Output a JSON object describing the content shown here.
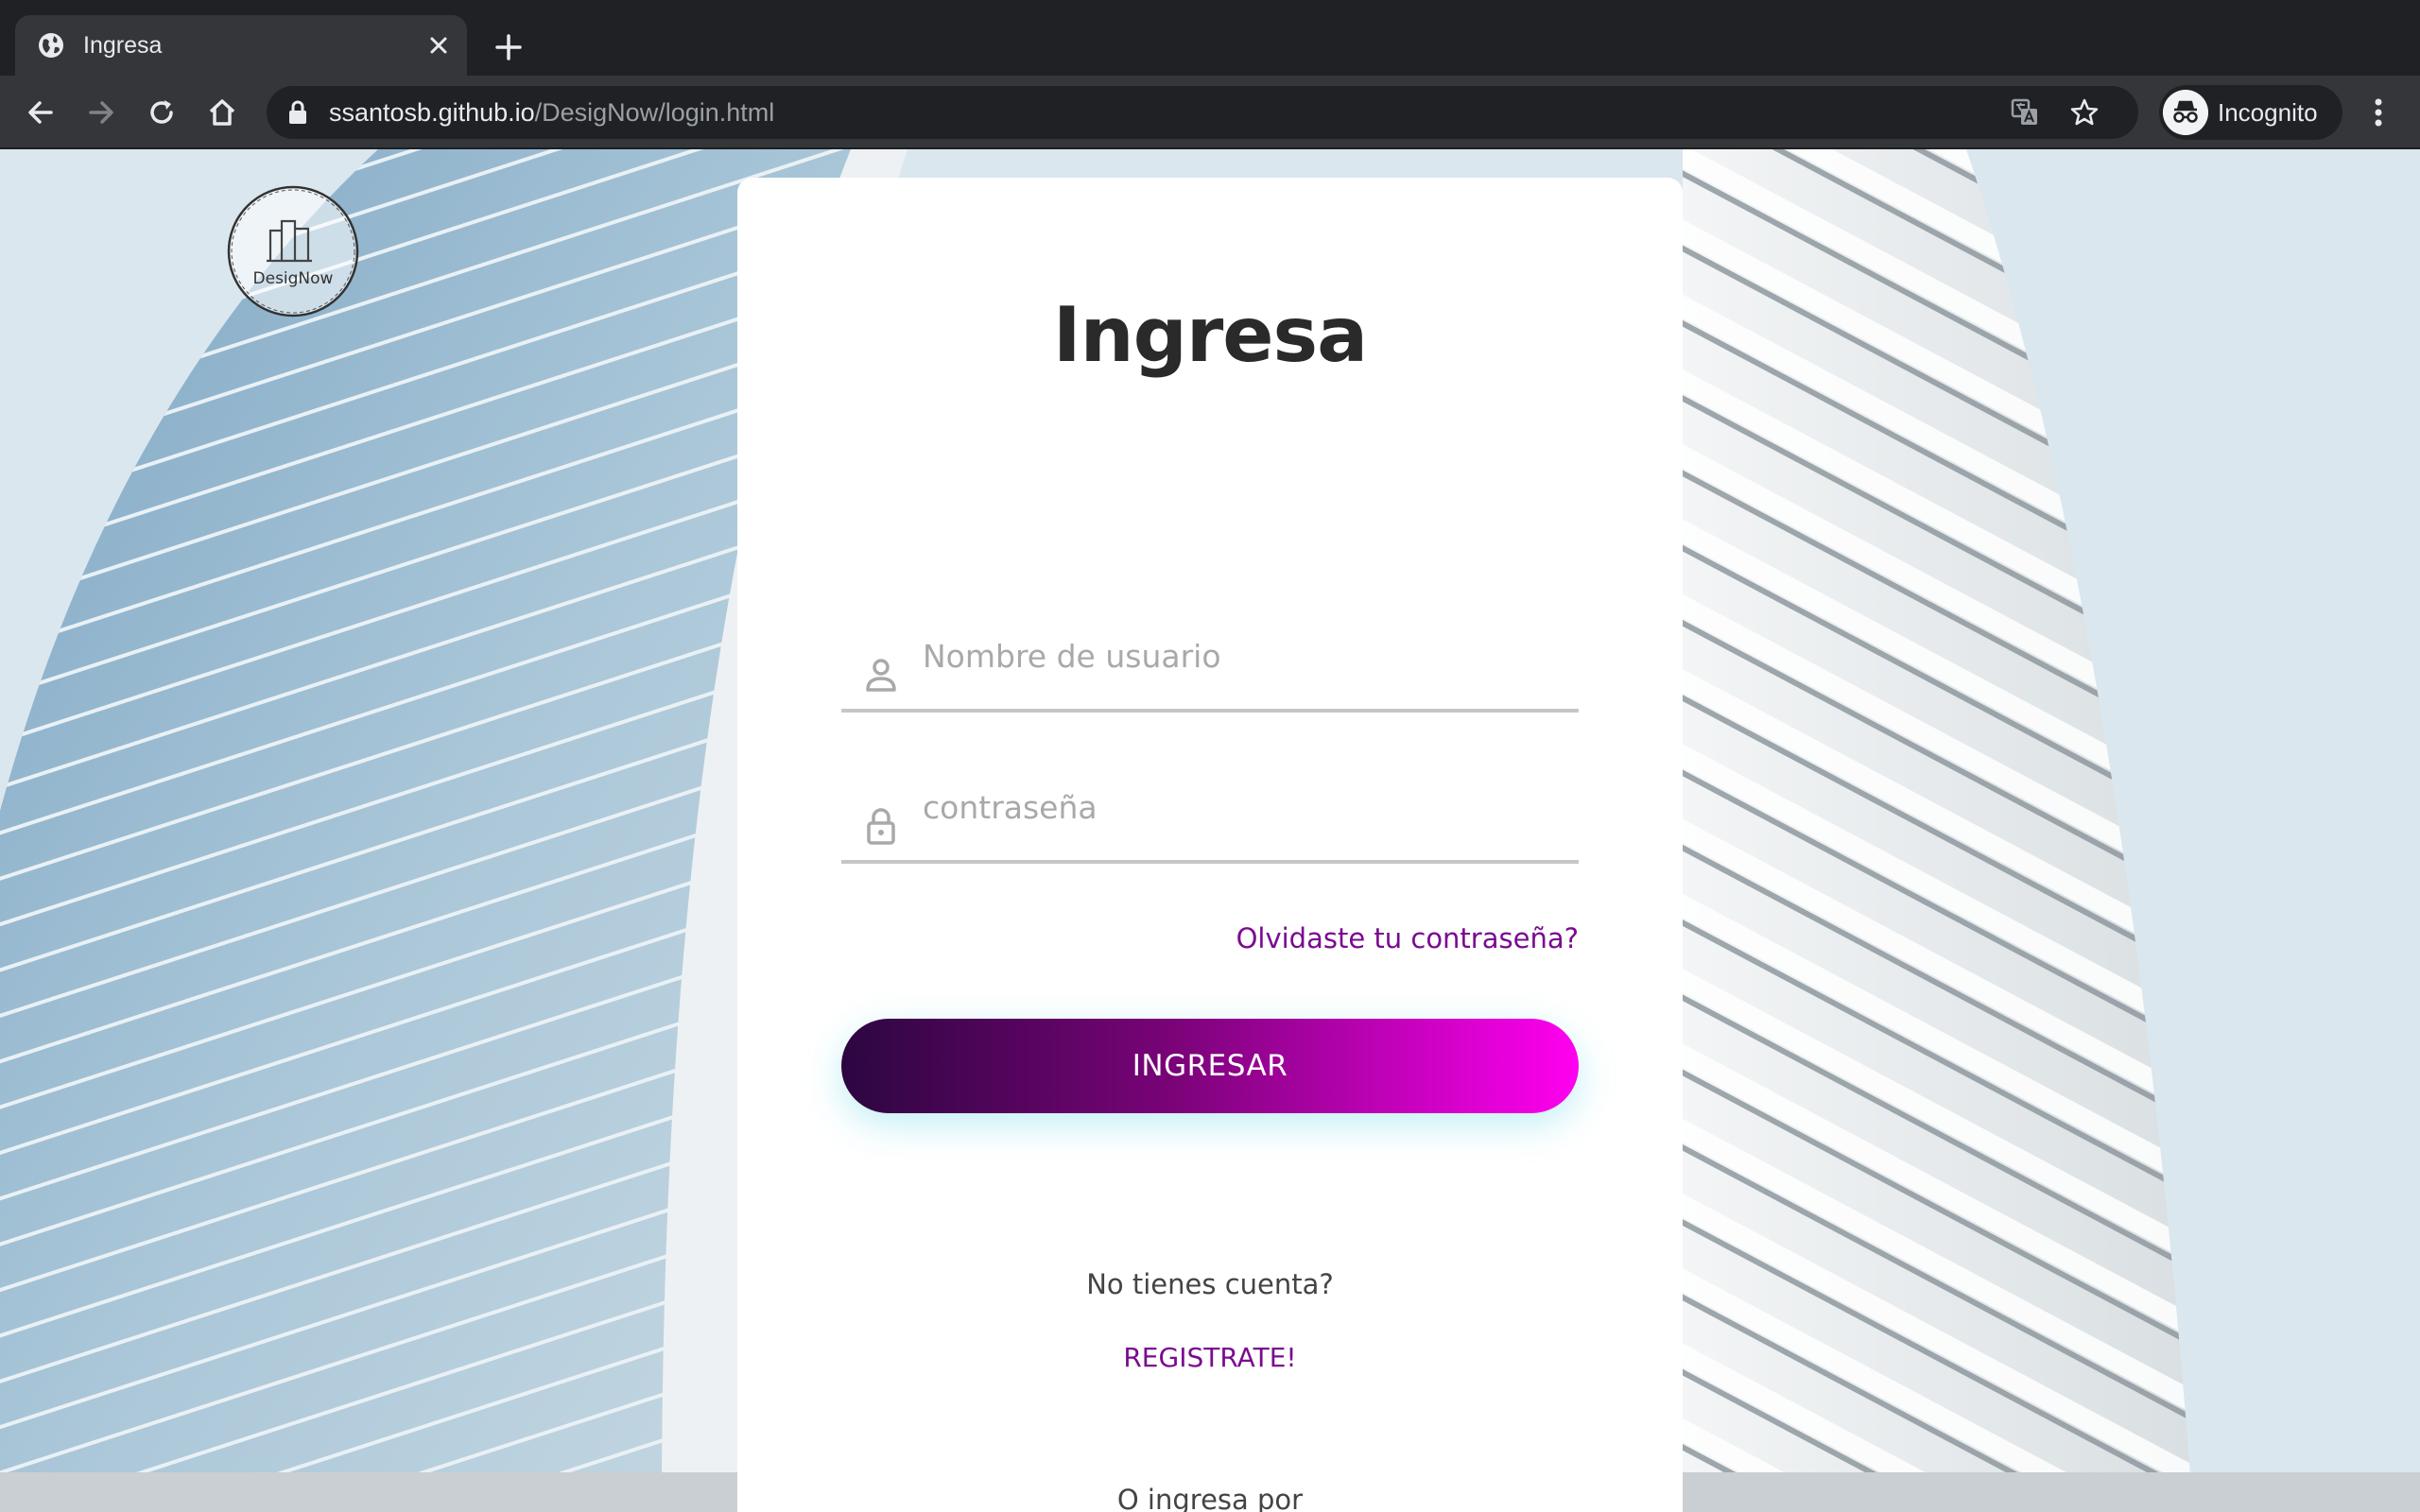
{
  "browser": {
    "tab_title": "Ingresa",
    "url_host": "ssantosb.github.io",
    "url_path": "/DesigNow/login.html",
    "profile_label": "Incognito",
    "icons": [
      "globe-icon",
      "close-icon",
      "plus-icon",
      "back-icon",
      "forward-icon",
      "reload-icon",
      "home-icon",
      "lock-icon",
      "translate-icon",
      "star-icon",
      "incognito-icon",
      "more-vert-icon"
    ]
  },
  "brand": {
    "logo_text": "DesigNow"
  },
  "login": {
    "title": "Ingresa",
    "username_placeholder": "Nombre de usuario",
    "password_placeholder": "contraseña",
    "forgot_label": "Olvidaste tu contraseña?",
    "submit_label": "INGRESAR",
    "no_account_text": "No tienes cuenta?",
    "register_label": "REGISTRATE!",
    "alt_login_text": "O ingresa por"
  },
  "colors": {
    "accent": "#7a0a90",
    "button_gradient_start": "#2c0640",
    "button_gradient_end": "#ff00f0"
  }
}
